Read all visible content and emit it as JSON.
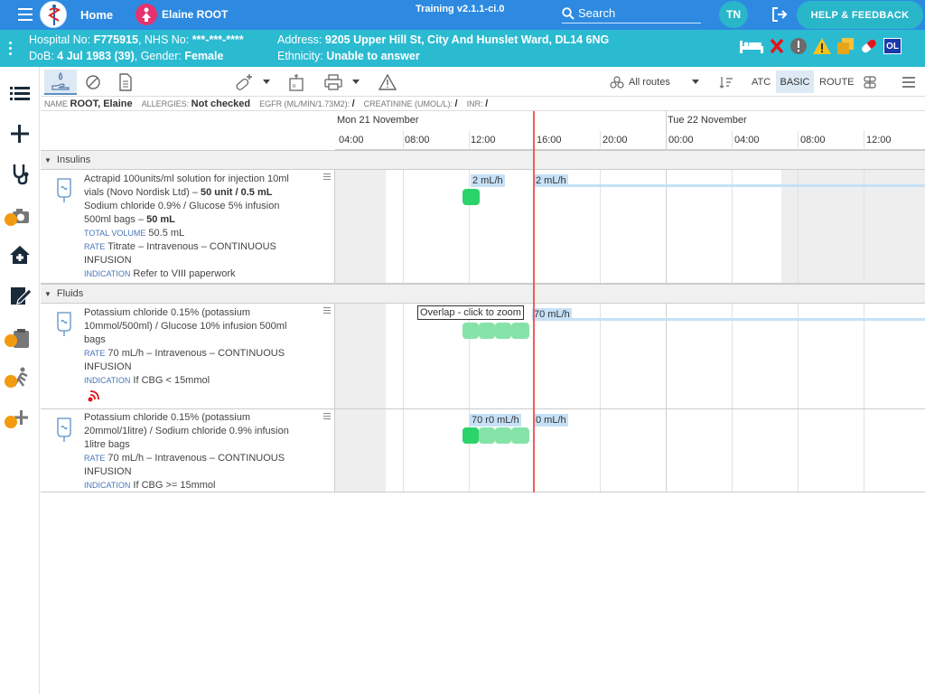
{
  "header": {
    "home_label": "Home",
    "patient_name": "Elaine ROOT",
    "environment": "Training v2.1.1-ci.0",
    "search_placeholder": "Search",
    "user_initials": "TN",
    "help_label": "HELP & FEEDBACK"
  },
  "banner": {
    "hospital_no_label": "Hospital No:",
    "hospital_no": "F775915",
    "nhs_no_label": ", NHS No:",
    "nhs_no": "***-***-****",
    "dob_label": "DoB:",
    "dob": "4 Jul 1983 (39)",
    "gender_label": ", Gender:",
    "gender": "Female",
    "address_label": "Address:",
    "address": "9205 Upper Hill St, City And Hunslet Ward, DL14 6NG",
    "ethnicity_label": "Ethnicity:",
    "ethnicity": "Unable to answer",
    "ol_badge": "OL"
  },
  "toolbar": {
    "routes_label": "All routes",
    "atc_label": "ATC",
    "basic_label": "BASIC",
    "route_label": "ROUTE"
  },
  "infobar": {
    "name_label": "NAME",
    "name": "ROOT, Elaine",
    "allergies_label": "ALLERGIES:",
    "allergies": "Not checked",
    "egfr_label": "EGFR (ML/MIN/1.73M2):",
    "egfr": "/",
    "creat_label": "CREATININE (UMOL/L):",
    "creat": "/",
    "inr_label": "INR:",
    "inr": "/"
  },
  "timeline": {
    "day1": "Mon 21 November",
    "day2": "Tue 22 November",
    "ticks": [
      "04:00",
      "08:00",
      "12:00",
      "16:00",
      "20:00",
      "00:00",
      "04:00",
      "08:00",
      "12:00"
    ]
  },
  "sections": {
    "insulins": "Insulins",
    "fluids": "Fluids"
  },
  "rows": {
    "r1": {
      "line1": "Actrapid 100units/ml solution for injection 10ml",
      "line2a": "vials (Novo Nordisk Ltd) – ",
      "line2b": "50 unit / 0.5 mL",
      "line3": "Sodium chloride 0.9% / Glucose 5% infusion",
      "line4a": "500ml bags – ",
      "line4b": "50 mL",
      "tv_label": "TOTAL VOLUME",
      "tv": "50.5 mL",
      "rate_label": "RATE",
      "rate": "Titrate – Intravenous – CONTINUOUS",
      "rate2": "INFUSION",
      "ind_label": "INDICATION",
      "ind": "Refer to VIII paperwork",
      "rate_a": "2 mL/h",
      "rate_b": "2 mL/h"
    },
    "r2": {
      "line1": "Potassium chloride 0.15% (potassium",
      "line2": "10mmol/500ml) / Glucose 10% infusion 500ml",
      "line3": "bags",
      "rate_label": "RATE",
      "rate": "70 mL/h – Intravenous – CONTINUOUS",
      "rate2": "INFUSION",
      "ind_label": "INDICATION",
      "ind": "If CBG < 15mmol",
      "overlap": "Overlap - click to zoom",
      "rate_b": "70 mL/h"
    },
    "r3": {
      "line1": "Potassium chloride 0.15% (potassium",
      "line2": "20mmol/1litre) / Sodium chloride 0.9% infusion",
      "line3": "1litre bags",
      "rate_label": "RATE",
      "rate": "70 mL/h – Intravenous – CONTINUOUS",
      "rate2": "INFUSION",
      "ind_label": "INDICATION",
      "ind": "If CBG >= 15mmol",
      "rate_a": "70 r0 mL/h",
      "rate_b": "0 mL/h"
    }
  },
  "colors": {
    "topbar": "#2d8ae0",
    "banner": "#2bbbd1",
    "now_line": "#f25b5b",
    "admin_green": "#2bd46a",
    "admin_green_light": "#86e3a8",
    "rate_bar": "#c6e1f6"
  },
  "icons": {
    "menu": "hamburger-icon",
    "logo": "caduceus-logo",
    "patient": "female-person-icon",
    "search": "search-icon",
    "logout": "logout-icon",
    "bed": "bed-icon",
    "x": "red-x-icon",
    "alert": "exclamation-circle-icon",
    "warning": "warning-triangle-icon",
    "docs": "documents-icon",
    "pill": "pill-icon"
  }
}
